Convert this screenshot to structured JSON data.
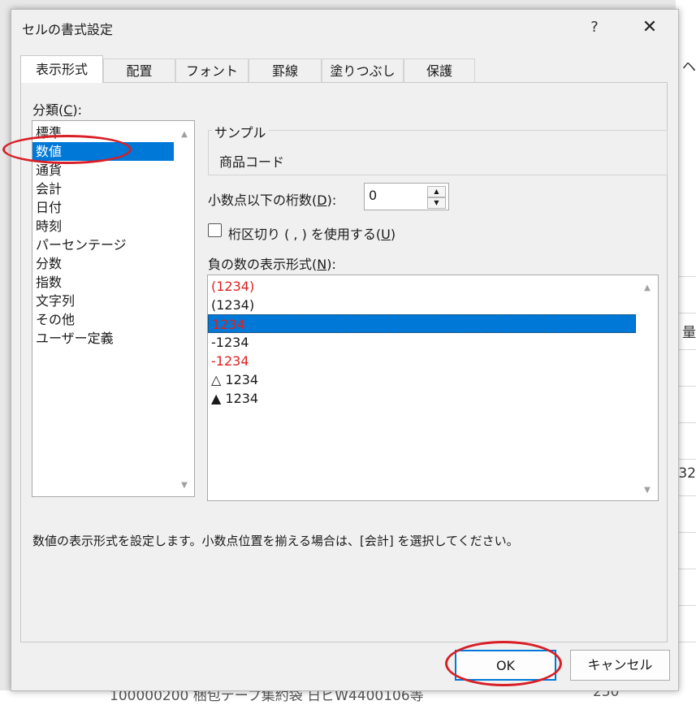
{
  "dialog": {
    "title": "セルの書式設定",
    "help_glyph": "?",
    "close_glyph": "✕"
  },
  "tabs": [
    {
      "label": "表示形式",
      "active": true
    },
    {
      "label": "配置",
      "active": false
    },
    {
      "label": "フォント",
      "active": false
    },
    {
      "label": "罫線",
      "active": false
    },
    {
      "label": "塗りつぶし",
      "active": false
    },
    {
      "label": "保護",
      "active": false
    }
  ],
  "category": {
    "label_text": "分類(",
    "label_key": "C",
    "label_end": "):",
    "selected": "数値",
    "items": [
      "標準",
      "数値",
      "通貨",
      "会計",
      "日付",
      "時刻",
      "パーセンテージ",
      "分数",
      "指数",
      "文字列",
      "その他",
      "ユーザー定義"
    ]
  },
  "sample": {
    "title": "サンプル",
    "value": "商品コード"
  },
  "decimal": {
    "label_text": "小数点以下の桁数(",
    "label_key": "D",
    "label_end": "):",
    "value": "0"
  },
  "separator": {
    "label_text": "桁区切り ( , ) を使用する(",
    "label_key": "U",
    "label_end": ")",
    "checked": false
  },
  "negative": {
    "label_text": "負の数の表示形式(",
    "label_key": "N",
    "label_end": "):",
    "items": [
      {
        "text": "(1234)",
        "red": true
      },
      {
        "text": "(1234)",
        "red": false
      },
      {
        "text": "1234",
        "red": true,
        "selected": true
      },
      {
        "text": "-1234",
        "red": false
      },
      {
        "text": "-1234",
        "red": true
      },
      {
        "text": "△ 1234",
        "red": false
      },
      {
        "text": "▲ 1234",
        "red": false
      }
    ]
  },
  "description": "数値の表示形式を設定します。小数点位置を揃える場合は、[会計] を選択してください。",
  "buttons": {
    "ok": "OK",
    "cancel": "キャンセル"
  },
  "background": {
    "right_chars": [
      "ヘ",
      "量",
      "32"
    ],
    "bottom_text": "100000200 梱包テープ集約袋 日ビW4400106等",
    "bottom_number": "250"
  },
  "colors": {
    "selection": "#0078d7",
    "negative_red": "#e0201e",
    "annotation_ring": "#d81f26"
  }
}
